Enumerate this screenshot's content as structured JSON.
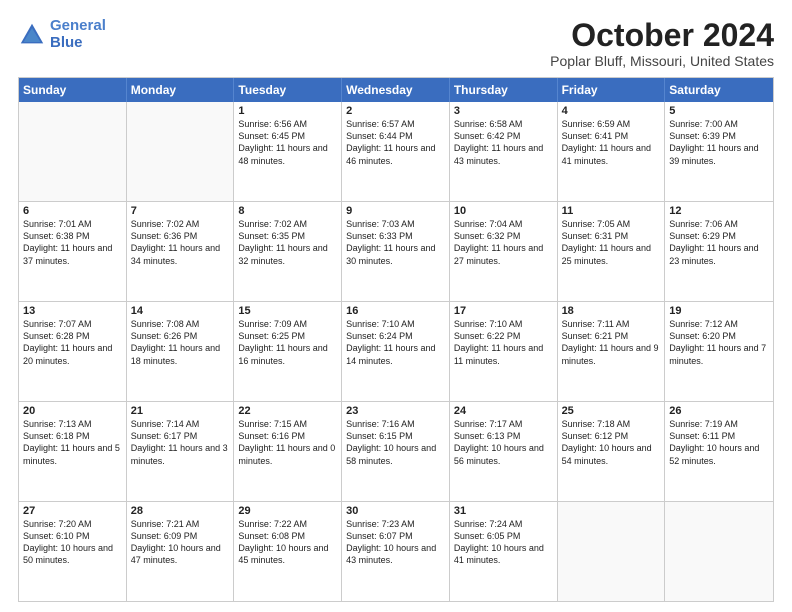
{
  "logo": {
    "line1": "General",
    "line2": "Blue"
  },
  "title": "October 2024",
  "location": "Poplar Bluff, Missouri, United States",
  "headers": [
    "Sunday",
    "Monday",
    "Tuesday",
    "Wednesday",
    "Thursday",
    "Friday",
    "Saturday"
  ],
  "weeks": [
    [
      {
        "day": "",
        "empty": true
      },
      {
        "day": "",
        "empty": true
      },
      {
        "day": "1",
        "sunrise": "Sunrise: 6:56 AM",
        "sunset": "Sunset: 6:45 PM",
        "daylight": "Daylight: 11 hours and 48 minutes."
      },
      {
        "day": "2",
        "sunrise": "Sunrise: 6:57 AM",
        "sunset": "Sunset: 6:44 PM",
        "daylight": "Daylight: 11 hours and 46 minutes."
      },
      {
        "day": "3",
        "sunrise": "Sunrise: 6:58 AM",
        "sunset": "Sunset: 6:42 PM",
        "daylight": "Daylight: 11 hours and 43 minutes."
      },
      {
        "day": "4",
        "sunrise": "Sunrise: 6:59 AM",
        "sunset": "Sunset: 6:41 PM",
        "daylight": "Daylight: 11 hours and 41 minutes."
      },
      {
        "day": "5",
        "sunrise": "Sunrise: 7:00 AM",
        "sunset": "Sunset: 6:39 PM",
        "daylight": "Daylight: 11 hours and 39 minutes."
      }
    ],
    [
      {
        "day": "6",
        "sunrise": "Sunrise: 7:01 AM",
        "sunset": "Sunset: 6:38 PM",
        "daylight": "Daylight: 11 hours and 37 minutes."
      },
      {
        "day": "7",
        "sunrise": "Sunrise: 7:02 AM",
        "sunset": "Sunset: 6:36 PM",
        "daylight": "Daylight: 11 hours and 34 minutes."
      },
      {
        "day": "8",
        "sunrise": "Sunrise: 7:02 AM",
        "sunset": "Sunset: 6:35 PM",
        "daylight": "Daylight: 11 hours and 32 minutes."
      },
      {
        "day": "9",
        "sunrise": "Sunrise: 7:03 AM",
        "sunset": "Sunset: 6:33 PM",
        "daylight": "Daylight: 11 hours and 30 minutes."
      },
      {
        "day": "10",
        "sunrise": "Sunrise: 7:04 AM",
        "sunset": "Sunset: 6:32 PM",
        "daylight": "Daylight: 11 hours and 27 minutes."
      },
      {
        "day": "11",
        "sunrise": "Sunrise: 7:05 AM",
        "sunset": "Sunset: 6:31 PM",
        "daylight": "Daylight: 11 hours and 25 minutes."
      },
      {
        "day": "12",
        "sunrise": "Sunrise: 7:06 AM",
        "sunset": "Sunset: 6:29 PM",
        "daylight": "Daylight: 11 hours and 23 minutes."
      }
    ],
    [
      {
        "day": "13",
        "sunrise": "Sunrise: 7:07 AM",
        "sunset": "Sunset: 6:28 PM",
        "daylight": "Daylight: 11 hours and 20 minutes."
      },
      {
        "day": "14",
        "sunrise": "Sunrise: 7:08 AM",
        "sunset": "Sunset: 6:26 PM",
        "daylight": "Daylight: 11 hours and 18 minutes."
      },
      {
        "day": "15",
        "sunrise": "Sunrise: 7:09 AM",
        "sunset": "Sunset: 6:25 PM",
        "daylight": "Daylight: 11 hours and 16 minutes."
      },
      {
        "day": "16",
        "sunrise": "Sunrise: 7:10 AM",
        "sunset": "Sunset: 6:24 PM",
        "daylight": "Daylight: 11 hours and 14 minutes."
      },
      {
        "day": "17",
        "sunrise": "Sunrise: 7:10 AM",
        "sunset": "Sunset: 6:22 PM",
        "daylight": "Daylight: 11 hours and 11 minutes."
      },
      {
        "day": "18",
        "sunrise": "Sunrise: 7:11 AM",
        "sunset": "Sunset: 6:21 PM",
        "daylight": "Daylight: 11 hours and 9 minutes."
      },
      {
        "day": "19",
        "sunrise": "Sunrise: 7:12 AM",
        "sunset": "Sunset: 6:20 PM",
        "daylight": "Daylight: 11 hours and 7 minutes."
      }
    ],
    [
      {
        "day": "20",
        "sunrise": "Sunrise: 7:13 AM",
        "sunset": "Sunset: 6:18 PM",
        "daylight": "Daylight: 11 hours and 5 minutes."
      },
      {
        "day": "21",
        "sunrise": "Sunrise: 7:14 AM",
        "sunset": "Sunset: 6:17 PM",
        "daylight": "Daylight: 11 hours and 3 minutes."
      },
      {
        "day": "22",
        "sunrise": "Sunrise: 7:15 AM",
        "sunset": "Sunset: 6:16 PM",
        "daylight": "Daylight: 11 hours and 0 minutes."
      },
      {
        "day": "23",
        "sunrise": "Sunrise: 7:16 AM",
        "sunset": "Sunset: 6:15 PM",
        "daylight": "Daylight: 10 hours and 58 minutes."
      },
      {
        "day": "24",
        "sunrise": "Sunrise: 7:17 AM",
        "sunset": "Sunset: 6:13 PM",
        "daylight": "Daylight: 10 hours and 56 minutes."
      },
      {
        "day": "25",
        "sunrise": "Sunrise: 7:18 AM",
        "sunset": "Sunset: 6:12 PM",
        "daylight": "Daylight: 10 hours and 54 minutes."
      },
      {
        "day": "26",
        "sunrise": "Sunrise: 7:19 AM",
        "sunset": "Sunset: 6:11 PM",
        "daylight": "Daylight: 10 hours and 52 minutes."
      }
    ],
    [
      {
        "day": "27",
        "sunrise": "Sunrise: 7:20 AM",
        "sunset": "Sunset: 6:10 PM",
        "daylight": "Daylight: 10 hours and 50 minutes."
      },
      {
        "day": "28",
        "sunrise": "Sunrise: 7:21 AM",
        "sunset": "Sunset: 6:09 PM",
        "daylight": "Daylight: 10 hours and 47 minutes."
      },
      {
        "day": "29",
        "sunrise": "Sunrise: 7:22 AM",
        "sunset": "Sunset: 6:08 PM",
        "daylight": "Daylight: 10 hours and 45 minutes."
      },
      {
        "day": "30",
        "sunrise": "Sunrise: 7:23 AM",
        "sunset": "Sunset: 6:07 PM",
        "daylight": "Daylight: 10 hours and 43 minutes."
      },
      {
        "day": "31",
        "sunrise": "Sunrise: 7:24 AM",
        "sunset": "Sunset: 6:05 PM",
        "daylight": "Daylight: 10 hours and 41 minutes."
      },
      {
        "day": "",
        "empty": true
      },
      {
        "day": "",
        "empty": true
      }
    ]
  ]
}
